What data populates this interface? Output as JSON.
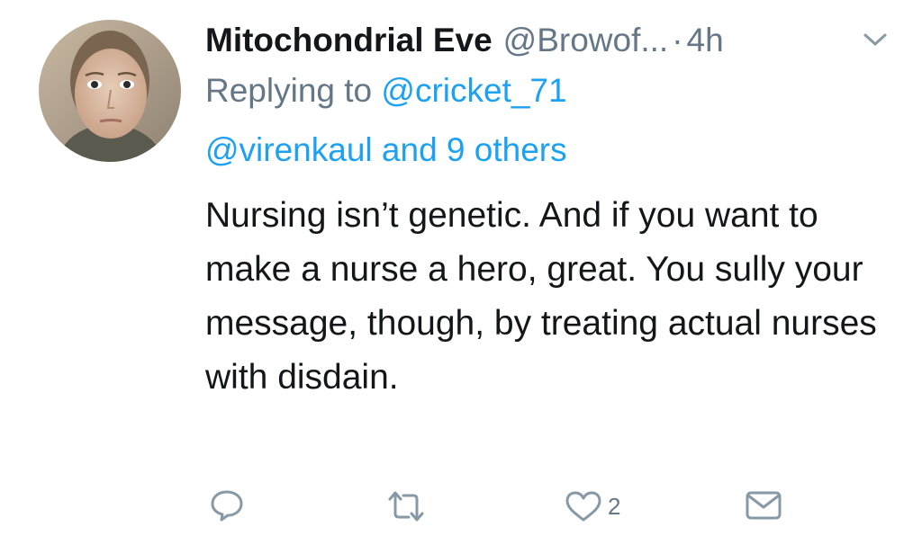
{
  "tweet": {
    "author": {
      "display_name": "Mitochondrial Eve",
      "handle": "@Browof...",
      "avatar_icon": "user-avatar-photo"
    },
    "separator": "·",
    "time": "4h",
    "replying": {
      "prefix": "Replying to ",
      "user": "@cricket_71",
      "others_user": "@virenkaul",
      "others_text": " and 9 others"
    },
    "text": "Nursing isn’t genetic. And if you want to make a nurse a hero, great. You sully your message, though, by treating actual nurses with disdain.",
    "actions": {
      "reply_icon": "reply-icon",
      "retweet_icon": "retweet-icon",
      "like_icon": "heart-icon",
      "like_count": "2",
      "dm_icon": "envelope-icon"
    },
    "colors": {
      "text": "#14171a",
      "secondary": "#657786",
      "link": "#1da1f2"
    }
  }
}
